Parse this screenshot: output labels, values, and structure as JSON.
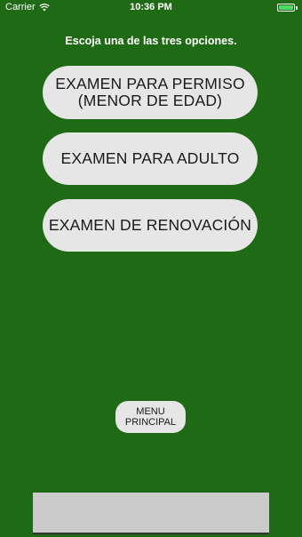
{
  "status_bar": {
    "carrier": "Carrier",
    "time": "10:36 PM",
    "icons": [
      "wifi-icon",
      "battery-icon"
    ],
    "battery_color": "#4cd964"
  },
  "instruction": "Escoja una de las tres opciones.",
  "options": [
    {
      "label": "EXAMEN PARA PERMISO\n(MENOR DE EDAD)"
    },
    {
      "label": "EXAMEN PARA ADULTO"
    },
    {
      "label": "EXAMEN DE RENOVACIÓN"
    }
  ],
  "menu_button": {
    "label": "MENU\nPRINCIPAL"
  },
  "colors": {
    "background": "#1f6a14",
    "button": "#e6e6e6",
    "ad_banner": "#cbcbcb"
  }
}
